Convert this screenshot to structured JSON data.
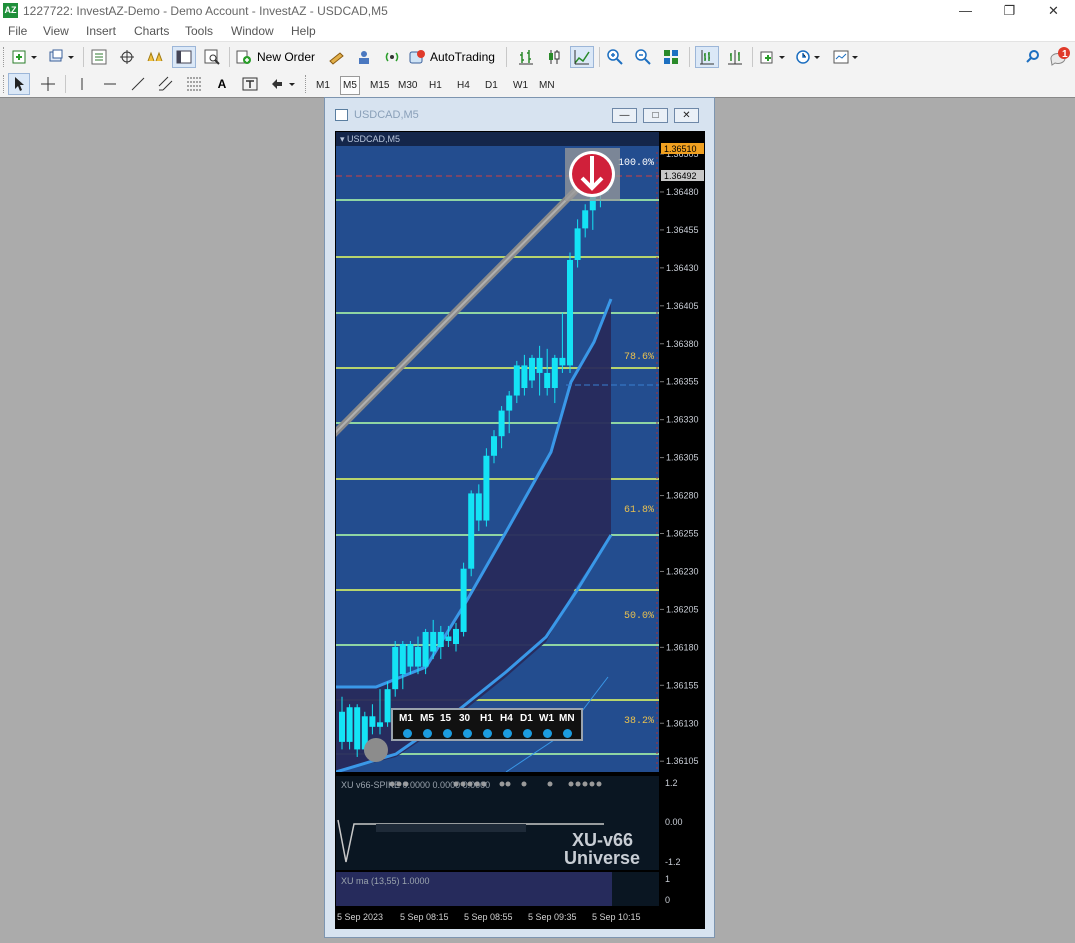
{
  "window": {
    "title": "1227722: InvestAZ-Demo - Demo Account - InvestAZ - USDCAD,M5",
    "app_icon": "AZ",
    "controls": {
      "minimize": "—",
      "restore": "❐",
      "close": "✕"
    }
  },
  "menu": [
    "File",
    "View",
    "Insert",
    "Charts",
    "Tools",
    "Window",
    "Help"
  ],
  "toolbar": {
    "new_order": "New Order",
    "auto_trading": "AutoTrading",
    "notification_count": "1"
  },
  "timeframes": [
    "M1",
    "M5",
    "M15",
    "M30",
    "H1",
    "H4",
    "D1",
    "W1",
    "MN"
  ],
  "active_timeframe": "M5",
  "chart_window": {
    "title": "USDCAD,M5",
    "symbol_label": "USDCAD,M5"
  },
  "price_axis": [
    "1.36505",
    "1.36480",
    "1.36455",
    "1.36430",
    "1.36405",
    "1.36380",
    "1.36355",
    "1.36330",
    "1.36305",
    "1.36280",
    "1.36255",
    "1.36230",
    "1.36205",
    "1.36180",
    "1.36155",
    "1.36130",
    "1.36105"
  ],
  "price_tags": {
    "high": "1.36510",
    "current": "1.36492"
  },
  "fib_labels": [
    "100.0%",
    "78.6%",
    "61.8%",
    "50.0%",
    "38.2%"
  ],
  "indicator1": {
    "label": "XU v66-SPIKE 0.0000 0.0000 0.0000",
    "scale": [
      "1.2",
      "0.00",
      "-1.2"
    ],
    "watermark1": "XU-v66",
    "watermark2": "Universe"
  },
  "indicator2": {
    "label": "XU ma (13,55) 1.0000",
    "scale": [
      "1",
      "0"
    ]
  },
  "time_axis": [
    "5 Sep 2023",
    "5 Sep 08:15",
    "5 Sep 08:55",
    "5 Sep 09:35",
    "5 Sep 10:15"
  ],
  "tf_panel": [
    "M1",
    "M5",
    "15",
    "30",
    "H1",
    "H4",
    "D1",
    "W1",
    "MN"
  ],
  "colors": {
    "plot_bg": "#234d8f",
    "candle": "#14e3f5",
    "ribbon": "#282a5c",
    "line": "#3a98e8",
    "fib_line": "#9be4a6",
    "highlight": "#f0a020"
  },
  "chart_data": {
    "type": "candlestick",
    "symbol": "USDCAD",
    "timeframe": "M5",
    "ylim": [
      1.36095,
      1.3652
    ],
    "candles": [
      [
        1.36135,
        1.36145,
        1.3611,
        1.36115
      ],
      [
        1.36115,
        1.3614,
        1.3611,
        1.36138
      ],
      [
        1.36138,
        1.3614,
        1.36105,
        1.3611
      ],
      [
        1.3611,
        1.36135,
        1.36108,
        1.36132
      ],
      [
        1.36132,
        1.3614,
        1.3612,
        1.36125
      ],
      [
        1.36125,
        1.3615,
        1.3612,
        1.36128
      ],
      [
        1.36128,
        1.36155,
        1.36125,
        1.3615
      ],
      [
        1.3615,
        1.36182,
        1.36145,
        1.36178
      ],
      [
        1.3616,
        1.36182,
        1.3615,
        1.3618
      ],
      [
        1.36165,
        1.36182,
        1.3616,
        1.3618
      ],
      [
        1.36178,
        1.36185,
        1.3616,
        1.36165
      ],
      [
        1.36165,
        1.3619,
        1.3616,
        1.36188
      ],
      [
        1.36188,
        1.36196,
        1.3617,
        1.36175
      ],
      [
        1.36178,
        1.36192,
        1.3617,
        1.36188
      ],
      [
        1.36185,
        1.36192,
        1.36178,
        1.36182
      ],
      [
        1.3618,
        1.36194,
        1.36175,
        1.3619
      ],
      [
        1.36188,
        1.36234,
        1.36185,
        1.3623
      ],
      [
        1.3623,
        1.36282,
        1.36225,
        1.3628
      ],
      [
        1.3628,
        1.36286,
        1.36255,
        1.36262
      ],
      [
        1.36262,
        1.3631,
        1.36258,
        1.36305
      ],
      [
        1.36305,
        1.36322,
        1.363,
        1.36318
      ],
      [
        1.36318,
        1.36338,
        1.3631,
        1.36335
      ],
      [
        1.36335,
        1.36348,
        1.3632,
        1.36345
      ],
      [
        1.36345,
        1.36368,
        1.3634,
        1.36365
      ],
      [
        1.36365,
        1.36372,
        1.36345,
        1.3635
      ],
      [
        1.36355,
        1.36372,
        1.3635,
        1.3637
      ],
      [
        1.3637,
        1.36378,
        1.36345,
        1.3636
      ],
      [
        1.3636,
        1.36376,
        1.36345,
        1.3635
      ],
      [
        1.3635,
        1.36372,
        1.3634,
        1.3637
      ],
      [
        1.3637,
        1.364,
        1.3636,
        1.36365
      ],
      [
        1.36365,
        1.3644,
        1.3636,
        1.36435
      ],
      [
        1.36435,
        1.36462,
        1.3643,
        1.36456
      ],
      [
        1.36456,
        1.36472,
        1.3645,
        1.36468
      ],
      [
        1.36468,
        1.36485,
        1.36455,
        1.3648
      ],
      [
        1.3648,
        1.36495,
        1.3647,
        1.36488
      ],
      [
        1.36488,
        1.36495,
        1.3648,
        1.36492
      ]
    ],
    "fib_levels": [
      {
        "label": "100.0%",
        "price": 1.36492
      },
      {
        "label": "78.6%",
        "price": 1.36373
      },
      {
        "label": "61.8%",
        "price": 1.36274
      },
      {
        "label": "50.0%",
        "price": 1.36205
      },
      {
        "label": "38.2%",
        "price": 1.36135
      }
    ]
  }
}
